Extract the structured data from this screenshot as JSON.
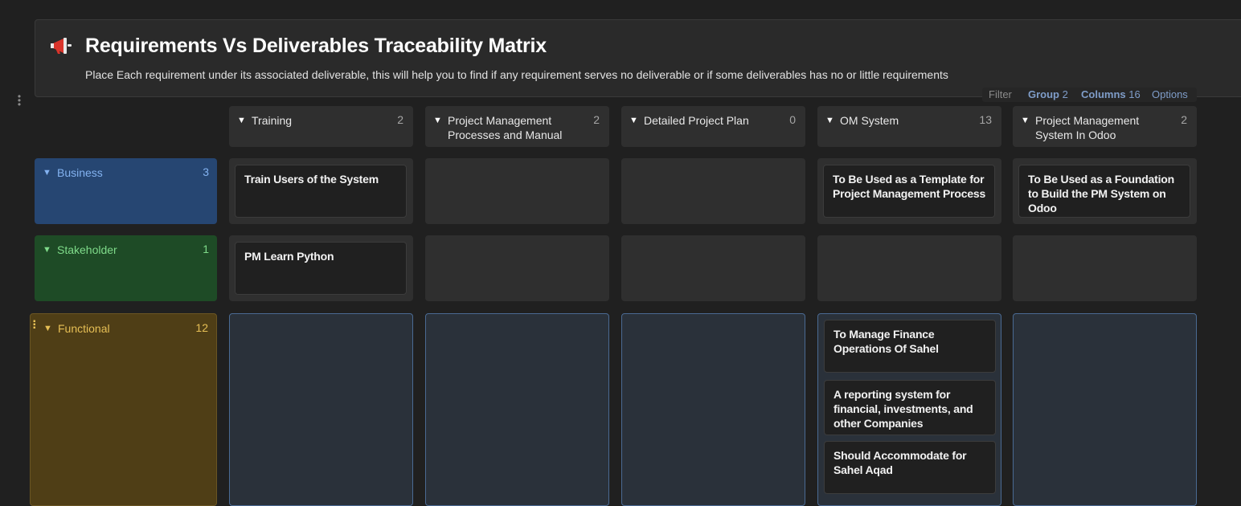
{
  "header": {
    "icon": "megaphone-icon",
    "title": "Requirements Vs Deliverables Traceability Matrix",
    "subtitle": "Place Each requirement under its associated deliverable, this will help you to find if any requirement serves no deliverable or if some deliverables has no or little requirements"
  },
  "toolbar": {
    "filter": "Filter",
    "group": "Group",
    "group_count": "2",
    "columns": "Columns",
    "columns_count": "16",
    "options": "Options"
  },
  "columns": [
    {
      "label": "Training",
      "count": "2"
    },
    {
      "label": "Project Management Processes and Manual",
      "count": "2"
    },
    {
      "label": "Detailed Project Plan",
      "count": "0"
    },
    {
      "label": "OM System",
      "count": "13"
    },
    {
      "label": "Project Management System In Odoo",
      "count": "2"
    }
  ],
  "rows": [
    {
      "label": "Business",
      "count": "3"
    },
    {
      "label": "Stakeholder",
      "count": "1"
    },
    {
      "label": "Functional",
      "count": "12"
    }
  ],
  "cards": {
    "business_training": "Train Users of the System",
    "business_om": "To Be Used as a Template for Project Management Process",
    "business_odoo": "To Be Used as a Foundation to Build the PM System on Odoo",
    "stakeholder_training": "PM Learn Python",
    "functional_om": [
      "To Manage Finance Operations Of Sahel",
      "A reporting system for financial, investments, and other Companies",
      "Should Accommodate for Sahel Aqad"
    ]
  },
  "colors": {
    "business": "#264672",
    "stakeholder": "#1e4b26",
    "functional": "#4f3e16",
    "accent": "#7f9dc9"
  }
}
